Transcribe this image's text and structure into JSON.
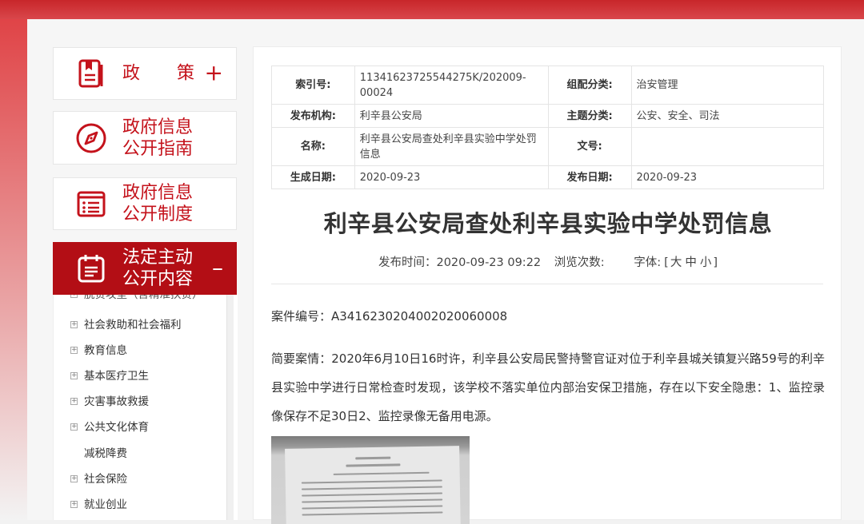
{
  "sidebar": {
    "policy": {
      "label": "政策",
      "toggle": "+"
    },
    "guide": {
      "label": "政府信息\n公开指南"
    },
    "system": {
      "label": "政府信息\n公开制度"
    },
    "mandatory": {
      "label": "法定主动\n公开内容",
      "toggle": "–"
    },
    "sub_items": [
      {
        "label": "社会救助和社会福利",
        "expandable": true
      },
      {
        "label": "教育信息",
        "expandable": true
      },
      {
        "label": "基本医疗卫生",
        "expandable": true
      },
      {
        "label": "灾害事故救援",
        "expandable": true
      },
      {
        "label": "公共文化体育",
        "expandable": true
      },
      {
        "label": "减税降费",
        "expandable": false
      },
      {
        "label": "社会保险",
        "expandable": true
      },
      {
        "label": "就业创业",
        "expandable": true
      }
    ],
    "sub_cut_label": "脱贫攻坚（含精准扶贫）"
  },
  "meta": {
    "index_no_label": "索引号:",
    "index_no": "11341623725544275K/202009-00024",
    "category_label": "组配分类:",
    "category": "治安管理",
    "publisher_label": "发布机构:",
    "publisher": "利辛县公安局",
    "topic_label": "主题分类:",
    "topic": "公安、安全、司法",
    "name_label": "名称:",
    "name": "利辛县公安局查处利辛县实验中学处罚信息",
    "doc_no_label": "文号:",
    "doc_no": "",
    "created_label": "生成日期:",
    "created": "2020-09-23",
    "published_label": "发布日期:",
    "published": "2020-09-23"
  },
  "article": {
    "title": "利辛县公安局查处利辛县实验中学处罚信息",
    "pub_time_label": "发布时间：",
    "pub_time": "2020-09-23 09:22",
    "views_label": "浏览次数:",
    "font_label": "字体:",
    "font_open": "[",
    "font_large": "大",
    "font_medium": "中",
    "font_small": "小",
    "font_close": "]",
    "case_no": "案件编号：A3416230204002020060008",
    "brief": "简要案情：2020年6月10日16时许，利辛县公安局民警持警官证对位于利辛县城关镇复兴路59号的利辛县实验中学进行日常检查时发现，该学校不落实单位内部治安保卫措施，存在以下安全隐患：1、监控录像保存不足30日2、监控录像无备用电源。"
  },
  "colors": {
    "brand_red": "#c4121b",
    "active_bg": "#b30e15",
    "top_band": "#c8262a"
  },
  "icons": {
    "policy": "document-bookmark-icon",
    "guide": "compass-icon",
    "system": "list-board-icon",
    "mandatory": "clipboard-icon"
  }
}
